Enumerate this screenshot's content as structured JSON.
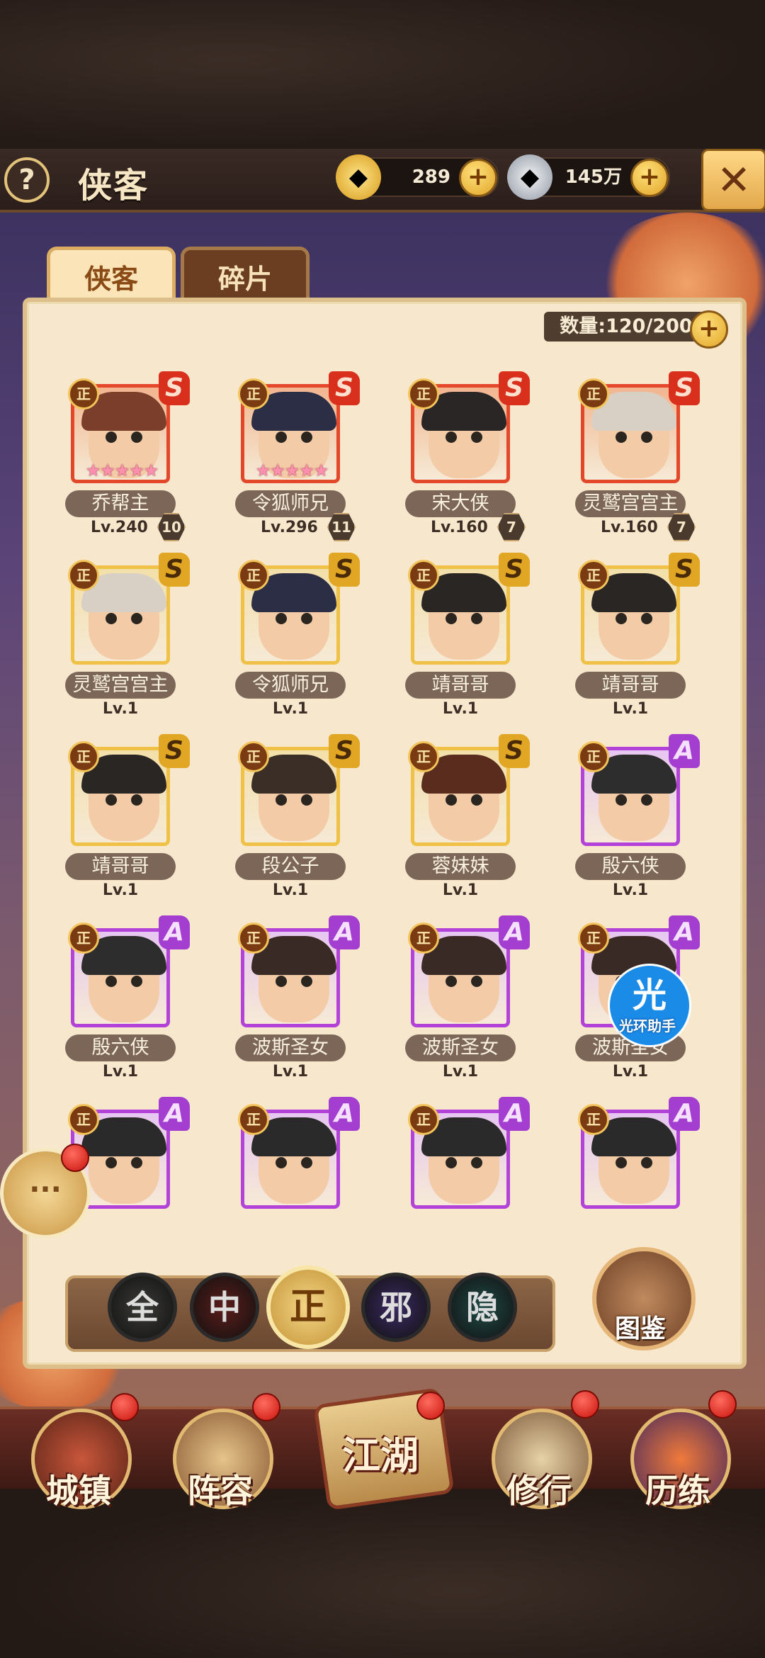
{
  "header": {
    "help_label": "?",
    "title": "侠客",
    "gold_value": "289",
    "silver_value": "145万",
    "plus_label": "+",
    "close_label": "✕"
  },
  "tabs": [
    {
      "label": "侠客",
      "active": true
    },
    {
      "label": "碎片",
      "active": false
    }
  ],
  "count": {
    "label": "数量:120/200"
  },
  "heroes": [
    {
      "name": "乔帮主",
      "level": "Lv.240",
      "rank": "10",
      "grade": "S",
      "faction": "正",
      "tier": "red",
      "stars": "★★★★★"
    },
    {
      "name": "令狐师兄",
      "level": "Lv.296",
      "rank": "11",
      "grade": "S",
      "faction": "正",
      "tier": "red",
      "stars": "★★★★★"
    },
    {
      "name": "宋大侠",
      "level": "Lv.160",
      "rank": "7",
      "grade": "S",
      "faction": "正",
      "tier": "red",
      "stars": ""
    },
    {
      "name": "灵鹫宫宫主",
      "level": "Lv.160",
      "rank": "7",
      "grade": "S",
      "faction": "正",
      "tier": "red",
      "stars": ""
    },
    {
      "name": "灵鹫宫宫主",
      "level": "Lv.1",
      "rank": "",
      "grade": "S",
      "faction": "正",
      "tier": "gold",
      "stars": ""
    },
    {
      "name": "令狐师兄",
      "level": "Lv.1",
      "rank": "",
      "grade": "S",
      "faction": "正",
      "tier": "gold",
      "stars": ""
    },
    {
      "name": "靖哥哥",
      "level": "Lv.1",
      "rank": "",
      "grade": "S",
      "faction": "正",
      "tier": "gold",
      "stars": ""
    },
    {
      "name": "靖哥哥",
      "level": "Lv.1",
      "rank": "",
      "grade": "S",
      "faction": "正",
      "tier": "gold",
      "stars": ""
    },
    {
      "name": "靖哥哥",
      "level": "Lv.1",
      "rank": "",
      "grade": "S",
      "faction": "正",
      "tier": "gold",
      "stars": ""
    },
    {
      "name": "段公子",
      "level": "Lv.1",
      "rank": "",
      "grade": "S",
      "faction": "正",
      "tier": "gold",
      "stars": ""
    },
    {
      "name": "蓉妹妹",
      "level": "Lv.1",
      "rank": "",
      "grade": "S",
      "faction": "正",
      "tier": "gold",
      "stars": ""
    },
    {
      "name": "殷六侠",
      "level": "Lv.1",
      "rank": "",
      "grade": "A",
      "faction": "正",
      "tier": "purple",
      "stars": ""
    },
    {
      "name": "殷六侠",
      "level": "Lv.1",
      "rank": "",
      "grade": "A",
      "faction": "正",
      "tier": "purple",
      "stars": ""
    },
    {
      "name": "波斯圣女",
      "level": "Lv.1",
      "rank": "",
      "grade": "A",
      "faction": "正",
      "tier": "purple",
      "stars": ""
    },
    {
      "name": "波斯圣女",
      "level": "Lv.1",
      "rank": "",
      "grade": "A",
      "faction": "正",
      "tier": "purple",
      "stars": ""
    },
    {
      "name": "波斯圣女",
      "level": "Lv.1",
      "rank": "",
      "grade": "A",
      "faction": "正",
      "tier": "purple",
      "stars": ""
    },
    {
      "name": "",
      "level": "",
      "rank": "",
      "grade": "A",
      "faction": "正",
      "tier": "purple",
      "stars": ""
    },
    {
      "name": "",
      "level": "",
      "rank": "",
      "grade": "A",
      "faction": "正",
      "tier": "purple",
      "stars": ""
    },
    {
      "name": "",
      "level": "",
      "rank": "",
      "grade": "A",
      "faction": "正",
      "tier": "purple",
      "stars": ""
    },
    {
      "name": "",
      "level": "",
      "rank": "",
      "grade": "A",
      "faction": "正",
      "tier": "purple",
      "stars": ""
    }
  ],
  "filters": [
    {
      "label": "全",
      "active": false,
      "color": "#3b3a36"
    },
    {
      "label": "中",
      "active": false,
      "color": "#5a1d1a"
    },
    {
      "label": "正",
      "active": true,
      "color": "#c39234"
    },
    {
      "label": "邪",
      "active": false,
      "color": "#3b2a62"
    },
    {
      "label": "隐",
      "active": false,
      "color": "#1f4a46"
    }
  ],
  "atlas": {
    "label": "图鉴"
  },
  "chat": {
    "label": "···"
  },
  "watermark": {
    "icon_label": "光",
    "text": "光环助手"
  },
  "bottom_nav": [
    {
      "label": "城镇"
    },
    {
      "label": "阵容"
    },
    {
      "label": "江湖"
    },
    {
      "label": "修行"
    },
    {
      "label": "历练"
    }
  ],
  "colors": {
    "tier_red": "#e4482a",
    "tier_gold": "#efc247",
    "tier_purple": "#b343d8",
    "panel": "#f7e8cd",
    "accent": "#e1a528"
  }
}
